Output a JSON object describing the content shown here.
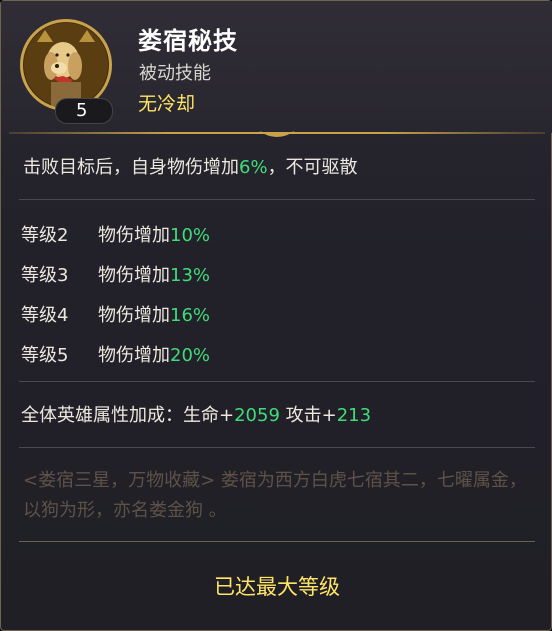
{
  "skill": {
    "title": "娄宿秘技",
    "type": "被动技能",
    "cooldown": "无冷却",
    "level": "5",
    "icon": "golden-dog-portrait-icon"
  },
  "description": {
    "prefix": "击败目标后，自身物伤增加",
    "value": "6%",
    "suffix": "，不可驱散"
  },
  "levels": [
    {
      "level": "等级2",
      "label": "物伤增加",
      "value": "10%"
    },
    {
      "level": "等级3",
      "label": "物伤增加",
      "value": "13%"
    },
    {
      "level": "等级4",
      "label": "物伤增加",
      "value": "16%"
    },
    {
      "level": "等级5",
      "label": "物伤增加",
      "value": "20%"
    }
  ],
  "bonus": {
    "prefix": "全体英雄属性加成：生命+",
    "hp": "2059",
    "mid": " 攻击+",
    "atk": "213"
  },
  "lore": "<娄宿三星，万物收藏> 娄宿为西方白虎七宿其二，七曜属金，以狗为形，亦名娄金狗 。",
  "footer": {
    "status": "已达最大等级"
  },
  "colors": {
    "accent_gold": "#c9a24a",
    "value_green": "#3fdc7a",
    "highlight_yellow": "#ffe566"
  }
}
